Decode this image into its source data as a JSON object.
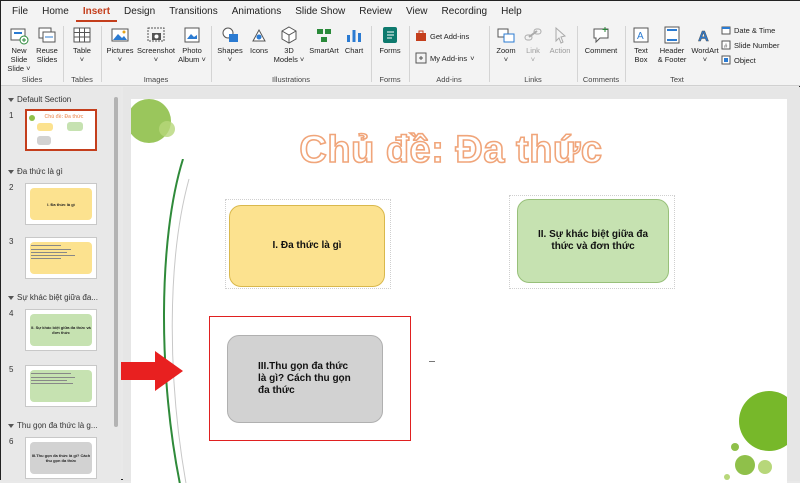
{
  "menu": {
    "tabs": [
      "File",
      "Home",
      "Insert",
      "Design",
      "Transitions",
      "Animations",
      "Slide Show",
      "Review",
      "View",
      "Recording",
      "Help"
    ],
    "active": "Insert"
  },
  "ribbon": {
    "groups": {
      "slides": "Slides",
      "tables": "Tables",
      "images": "Images",
      "illustrations": "Illustrations",
      "forms": "Forms",
      "addins": "Add-ins",
      "links": "Links",
      "comments": "Comments",
      "text": "Text"
    },
    "buttons": {
      "new_slide": "New Slide",
      "new_slide_2": "Slide ˅",
      "reuse_slides": "Reuse",
      "reuse_slides_2": "Slides",
      "table": "Table",
      "pictures": "Pictures",
      "screenshot": "Screenshot",
      "photo_album": "Photo",
      "photo_album_2": "Album ˅",
      "shapes": "Shapes",
      "icons": "Icons",
      "models_3d": "3D",
      "models_3d_2": "Models ˅",
      "smartart": "SmartArt",
      "chart": "Chart",
      "forms": "Forms",
      "get_addins": "Get Add-ins",
      "my_addins": "My Add-ins",
      "zoom": "Zoom",
      "link": "Link",
      "action": "Action",
      "comment": "Comment",
      "text_box": "Text",
      "text_box_2": "Box",
      "header_footer": "Header",
      "header_footer_2": "& Footer",
      "wordart": "WordArt",
      "date_time": "Date & Time",
      "slide_number": "Slide Number",
      "object": "Object"
    }
  },
  "panel": {
    "sections": [
      "Default Section",
      "Đa thức là gì",
      "Sự khác biệt giữa đa...",
      "Thu gọn đa thức là g..."
    ],
    "slides": [
      {
        "num": "1",
        "title": "Chủ đề: Đa thức"
      },
      {
        "num": "2",
        "text": "I. Đa thức là gì"
      },
      {
        "num": "3",
        "text": ""
      },
      {
        "num": "4",
        "text": "II. Sự khác biệt giữa đa thức và đơn thức"
      },
      {
        "num": "5",
        "text": ""
      },
      {
        "num": "6",
        "text": "III.Thu gọn đa thức là gì? Cách thu gọn đa thức"
      }
    ]
  },
  "slide": {
    "title": "Chủ đề: Đa thức",
    "box1": "I. Đa thức là gì",
    "box2": "II. Sự khác biệt giữa đa thức và đơn thức",
    "box3": "III.Thu gọn đa thức là gì? Cách thu gọn đa thức"
  },
  "colors": {
    "accent": "#c43e1c",
    "box_yellow": "#fce28f",
    "box_green": "#c6e2b1",
    "box_gray": "#d2d2d2",
    "arrow": "#e82020",
    "title_outline": "#f0a57a"
  }
}
